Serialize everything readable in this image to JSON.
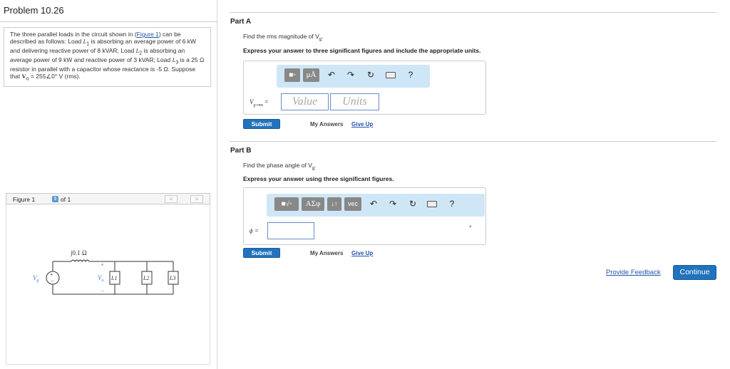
{
  "problem": {
    "title": "Problem 10.26",
    "text_1": "The three parallel loads in the circuit shown in (",
    "figure_link": "Figure 1",
    "text_2": ") can be described as follows: Load ",
    "L1": "L",
    "L1_sub": "1",
    "text_3": " is absorbing an average power of 6 kW and delivering reactive power of 8 kVAR; Load ",
    "L2": "L",
    "L2_sub": "2",
    "text_4": " is absorbing an average power of 9 kW and reactive power of 3 kVAR; Load ",
    "L3": "L",
    "L3_sub": "3",
    "text_5": " is a 25 Ω resistor in parallel with a capacitor whose reactance is -5 Ω. Suppose that ",
    "Vo": "V",
    "Vo_sub": "o",
    "text_6": " = 255∠0° V (rms)."
  },
  "figure": {
    "label": "Figure 1",
    "selector_icon": "up-down-arrows-icon",
    "of_text": "of 1",
    "prev": "<",
    "next": ">",
    "impedance_label": "j0.1 Ω",
    "source_plus": "+",
    "source_minus": "−",
    "vg_label": "V",
    "vg_sub": "g",
    "vo_label": "V",
    "vo_sub": "o",
    "plus": "+",
    "minus": "−",
    "load1": "L1",
    "load2": "L2",
    "load3": "L3"
  },
  "partA": {
    "title": "Part A",
    "question": "Find the rms magnitude of V",
    "question_sub": "g",
    "question_end": ".",
    "instruction": "Express your answer to three significant figures and include the appropriate units.",
    "toolbar": {
      "templates_icon": "templates-icon",
      "mu_label": "μÅ",
      "undo_icon": "undo-icon",
      "redo_icon": "redo-icon",
      "reset_icon": "reset-icon",
      "keyboard_icon": "keyboard-icon",
      "help": "?"
    },
    "label": "V",
    "label_sub": "g rms",
    "equals": "=",
    "value_placeholder": "Value",
    "units_placeholder": "Units",
    "submit": "Submit",
    "my_answers": "My Answers",
    "give_up": "Give Up"
  },
  "partB": {
    "title": "Part B",
    "question": "Find the phase angle of V",
    "question_sub": "g",
    "question_end": ".",
    "instruction": "Express your answer using three significant figures.",
    "toolbar": {
      "templates_icon": "templates-sqrt-icon",
      "greek_label": "ΑΣφ",
      "arrows_label": "↓↑",
      "vec_label": "vec",
      "undo_icon": "undo-icon",
      "redo_icon": "redo-icon",
      "reset_icon": "reset-icon",
      "keyboard_icon": "keyboard-icon",
      "help": "?"
    },
    "label": "ϕ =",
    "unit": "°",
    "submit": "Submit",
    "my_answers": "My Answers",
    "give_up": "Give Up"
  },
  "footer": {
    "feedback": "Provide Feedback",
    "continue": "Continue"
  }
}
